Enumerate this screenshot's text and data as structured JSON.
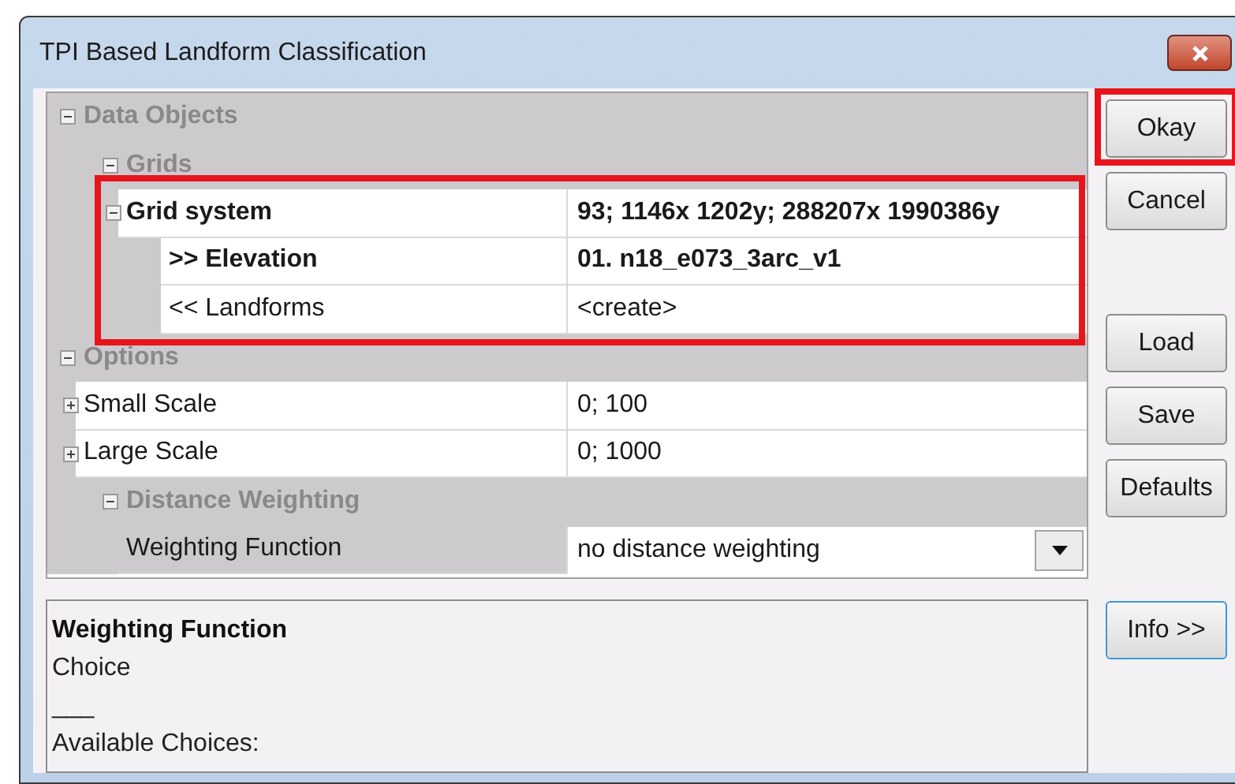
{
  "window": {
    "title": "TPI Based Landform Classification"
  },
  "properties": [
    {
      "kind": "category",
      "label": "Data Objects",
      "expanded": true,
      "children": [
        {
          "kind": "category",
          "label": "Grids",
          "expanded": true,
          "children": [
            {
              "kind": "property",
              "label": "Grid system",
              "value": "93; 1146x 1202y; 288207x 1990386y",
              "bold": true,
              "expanded": true,
              "highlighted": true,
              "selected": false,
              "children": [
                {
                  "kind": "property",
                  "label": ">> Elevation",
                  "value": "01. n18_e073_3arc_v1",
                  "bold": true,
                  "selected": false
                },
                {
                  "kind": "property",
                  "label": "<< Landforms",
                  "value": "<create>",
                  "bold": false,
                  "selected": false
                }
              ]
            }
          ]
        }
      ]
    },
    {
      "kind": "category",
      "label": "Options",
      "expanded": true,
      "children": [
        {
          "kind": "property",
          "label": "Small Scale",
          "value": "0; 100",
          "bold": false,
          "expanded": false,
          "selected": false
        },
        {
          "kind": "property",
          "label": "Large Scale",
          "value": "0; 1000",
          "bold": false,
          "expanded": false,
          "selected": false
        },
        {
          "kind": "category",
          "label": "Distance Weighting",
          "expanded": true,
          "children": [
            {
              "kind": "property",
              "label": "Weighting Function",
              "value": "no distance weighting",
              "bold": false,
              "dropdown": true,
              "selected": true
            }
          ]
        }
      ]
    }
  ],
  "info": {
    "title": "Weighting Function",
    "lines": [
      "Choice",
      "___",
      "Available Choices:"
    ]
  },
  "button_groups": [
    [
      {
        "label": "Okay",
        "highlighted": true,
        "focused": false
      },
      {
        "label": "Cancel",
        "highlighted": false,
        "focused": false
      }
    ],
    [
      {
        "label": "Load",
        "highlighted": false,
        "focused": false
      },
      {
        "label": "Save",
        "highlighted": false,
        "focused": false
      },
      {
        "label": "Defaults",
        "highlighted": false,
        "focused": false
      }
    ],
    [
      {
        "label": "Info >>",
        "highlighted": false,
        "focused": true
      }
    ]
  ]
}
